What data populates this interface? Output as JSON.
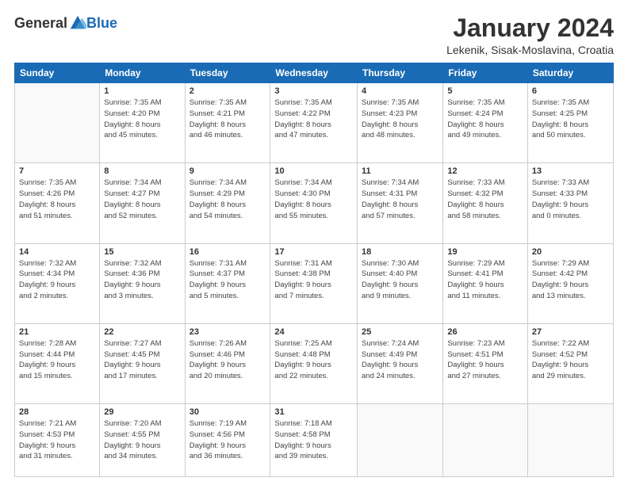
{
  "header": {
    "logo_general": "General",
    "logo_blue": "Blue",
    "title": "January 2024",
    "location": "Lekenik, Sisak-Moslavina, Croatia"
  },
  "days_of_week": [
    "Sunday",
    "Monday",
    "Tuesday",
    "Wednesday",
    "Thursday",
    "Friday",
    "Saturday"
  ],
  "weeks": [
    [
      {
        "day": "",
        "info": ""
      },
      {
        "day": "1",
        "info": "Sunrise: 7:35 AM\nSunset: 4:20 PM\nDaylight: 8 hours\nand 45 minutes."
      },
      {
        "day": "2",
        "info": "Sunrise: 7:35 AM\nSunset: 4:21 PM\nDaylight: 8 hours\nand 46 minutes."
      },
      {
        "day": "3",
        "info": "Sunrise: 7:35 AM\nSunset: 4:22 PM\nDaylight: 8 hours\nand 47 minutes."
      },
      {
        "day": "4",
        "info": "Sunrise: 7:35 AM\nSunset: 4:23 PM\nDaylight: 8 hours\nand 48 minutes."
      },
      {
        "day": "5",
        "info": "Sunrise: 7:35 AM\nSunset: 4:24 PM\nDaylight: 8 hours\nand 49 minutes."
      },
      {
        "day": "6",
        "info": "Sunrise: 7:35 AM\nSunset: 4:25 PM\nDaylight: 8 hours\nand 50 minutes."
      }
    ],
    [
      {
        "day": "7",
        "info": "Sunrise: 7:35 AM\nSunset: 4:26 PM\nDaylight: 8 hours\nand 51 minutes."
      },
      {
        "day": "8",
        "info": "Sunrise: 7:34 AM\nSunset: 4:27 PM\nDaylight: 8 hours\nand 52 minutes."
      },
      {
        "day": "9",
        "info": "Sunrise: 7:34 AM\nSunset: 4:29 PM\nDaylight: 8 hours\nand 54 minutes."
      },
      {
        "day": "10",
        "info": "Sunrise: 7:34 AM\nSunset: 4:30 PM\nDaylight: 8 hours\nand 55 minutes."
      },
      {
        "day": "11",
        "info": "Sunrise: 7:34 AM\nSunset: 4:31 PM\nDaylight: 8 hours\nand 57 minutes."
      },
      {
        "day": "12",
        "info": "Sunrise: 7:33 AM\nSunset: 4:32 PM\nDaylight: 8 hours\nand 58 minutes."
      },
      {
        "day": "13",
        "info": "Sunrise: 7:33 AM\nSunset: 4:33 PM\nDaylight: 9 hours\nand 0 minutes."
      }
    ],
    [
      {
        "day": "14",
        "info": "Sunrise: 7:32 AM\nSunset: 4:34 PM\nDaylight: 9 hours\nand 2 minutes."
      },
      {
        "day": "15",
        "info": "Sunrise: 7:32 AM\nSunset: 4:36 PM\nDaylight: 9 hours\nand 3 minutes."
      },
      {
        "day": "16",
        "info": "Sunrise: 7:31 AM\nSunset: 4:37 PM\nDaylight: 9 hours\nand 5 minutes."
      },
      {
        "day": "17",
        "info": "Sunrise: 7:31 AM\nSunset: 4:38 PM\nDaylight: 9 hours\nand 7 minutes."
      },
      {
        "day": "18",
        "info": "Sunrise: 7:30 AM\nSunset: 4:40 PM\nDaylight: 9 hours\nand 9 minutes."
      },
      {
        "day": "19",
        "info": "Sunrise: 7:29 AM\nSunset: 4:41 PM\nDaylight: 9 hours\nand 11 minutes."
      },
      {
        "day": "20",
        "info": "Sunrise: 7:29 AM\nSunset: 4:42 PM\nDaylight: 9 hours\nand 13 minutes."
      }
    ],
    [
      {
        "day": "21",
        "info": "Sunrise: 7:28 AM\nSunset: 4:44 PM\nDaylight: 9 hours\nand 15 minutes."
      },
      {
        "day": "22",
        "info": "Sunrise: 7:27 AM\nSunset: 4:45 PM\nDaylight: 9 hours\nand 17 minutes."
      },
      {
        "day": "23",
        "info": "Sunrise: 7:26 AM\nSunset: 4:46 PM\nDaylight: 9 hours\nand 20 minutes."
      },
      {
        "day": "24",
        "info": "Sunrise: 7:25 AM\nSunset: 4:48 PM\nDaylight: 9 hours\nand 22 minutes."
      },
      {
        "day": "25",
        "info": "Sunrise: 7:24 AM\nSunset: 4:49 PM\nDaylight: 9 hours\nand 24 minutes."
      },
      {
        "day": "26",
        "info": "Sunrise: 7:23 AM\nSunset: 4:51 PM\nDaylight: 9 hours\nand 27 minutes."
      },
      {
        "day": "27",
        "info": "Sunrise: 7:22 AM\nSunset: 4:52 PM\nDaylight: 9 hours\nand 29 minutes."
      }
    ],
    [
      {
        "day": "28",
        "info": "Sunrise: 7:21 AM\nSunset: 4:53 PM\nDaylight: 9 hours\nand 31 minutes."
      },
      {
        "day": "29",
        "info": "Sunrise: 7:20 AM\nSunset: 4:55 PM\nDaylight: 9 hours\nand 34 minutes."
      },
      {
        "day": "30",
        "info": "Sunrise: 7:19 AM\nSunset: 4:56 PM\nDaylight: 9 hours\nand 36 minutes."
      },
      {
        "day": "31",
        "info": "Sunrise: 7:18 AM\nSunset: 4:58 PM\nDaylight: 9 hours\nand 39 minutes."
      },
      {
        "day": "",
        "info": ""
      },
      {
        "day": "",
        "info": ""
      },
      {
        "day": "",
        "info": ""
      }
    ]
  ]
}
